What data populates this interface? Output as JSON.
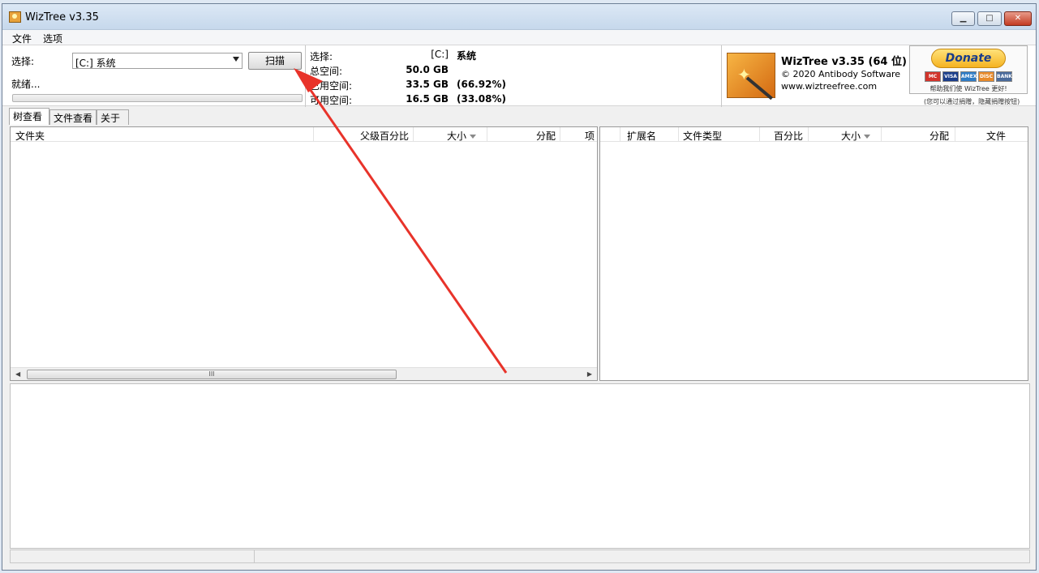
{
  "window": {
    "title": "WizTree v3.35"
  },
  "menu": {
    "file": "文件",
    "options": "选项"
  },
  "scan_panel": {
    "select_label": "选择:",
    "drive_value": "[C:] 系统",
    "scan_label": "扫描",
    "status": "就绪..."
  },
  "drive_info": {
    "select_label": "选择:",
    "drive_letter": "[C:]",
    "drive_name": "系统",
    "total_label": "总空间:",
    "total_value": "50.0 GB",
    "used_label": "已用空间:",
    "used_value": "33.5 GB",
    "used_pct": "(66.92%)",
    "free_label": "可用空间:",
    "free_value": "16.5 GB",
    "free_pct": "(33.08%)"
  },
  "about": {
    "product": "WizTree v3.35 (64 位)",
    "copyright": "© 2020 Antibody Software",
    "website": "www.wiztreefree.com"
  },
  "donate": {
    "button": "Donate",
    "cards": [
      "MC",
      "VISA",
      "AMEX",
      "DISC",
      "BANK"
    ],
    "note": "帮助我们使 WizTree 更好!",
    "note2": "(您可以通过捐赠，隐藏捐赠按钮)"
  },
  "tabs": [
    "树查看",
    "文件查看",
    "关于"
  ],
  "tree_columns": [
    "文件夹",
    "父级百分比",
    "大小",
    "分配",
    "项"
  ],
  "ext_columns": [
    "扩展名",
    "文件类型",
    "百分比",
    "大小",
    "分配",
    "文件"
  ],
  "scrollbar_grip": "III",
  "colors": {
    "annotation_arrow": "#e8332a",
    "titlebar": "#c6d8ec"
  }
}
